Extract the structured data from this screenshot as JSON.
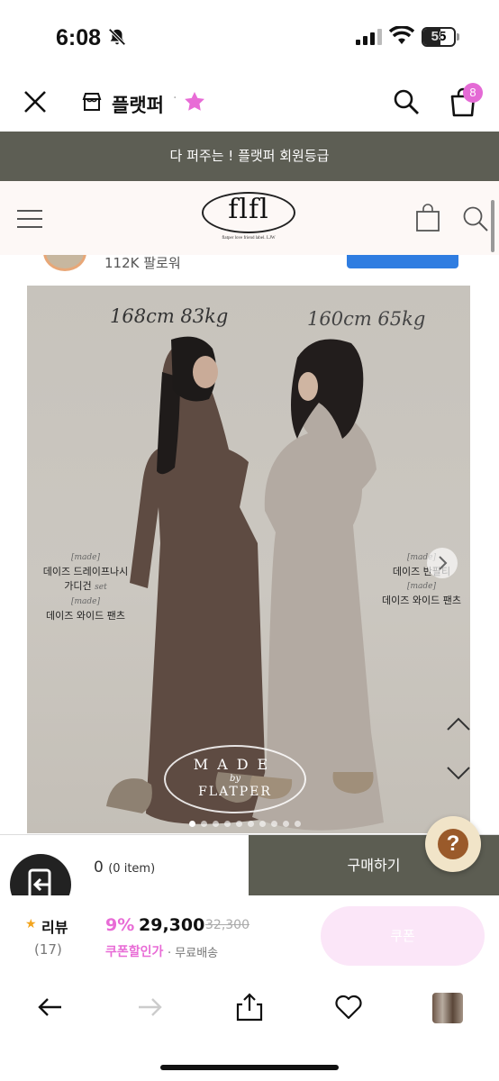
{
  "status_bar": {
    "time": "6:08",
    "battery": "55",
    "battery_level": 0.55
  },
  "app_header": {
    "store_name": "플랫퍼",
    "separator": "·",
    "cart_count": "8"
  },
  "banner": {
    "text": "다 퍼주는 ! 플랫퍼 회원등급"
  },
  "shop_header": {
    "logo_text": "flfl",
    "logo_tagline": "flatper love friend label. LJW"
  },
  "seller": {
    "followers": "112K 팔로워"
  },
  "product_image": {
    "left_model": "168cm 83kg",
    "right_model": "160cm 65kg",
    "left_caption": {
      "made1": "[made]",
      "line1": "데이즈 드레이프나시",
      "line2": "가디건",
      "set": "set",
      "made2": "[made]",
      "line3": "데이즈 와이드 팬츠"
    },
    "right_caption": {
      "made1": "[made]",
      "line1": "데이즈 반팔티",
      "made2": "[made]",
      "line2": "데이즈 와이드 팬츠"
    },
    "stamp": {
      "line1": "MADE",
      "line2": "by",
      "line3": "FLATPER"
    },
    "carousel": {
      "total": 10,
      "active": 0
    }
  },
  "buy_bar": {
    "count": "0",
    "count_suffix": "(0 item)",
    "buy_label": "구매하기"
  },
  "summary": {
    "review_label": "리뷰",
    "review_count": "(17)",
    "discount": "9%",
    "price": "29,300",
    "original_price": "32,300",
    "coupon_label": "쿠폰할인가",
    "shipping_sep": "·",
    "shipping": "무료배송",
    "cta_label": "쿠폰"
  },
  "help": {
    "symbol": "?"
  },
  "colors": {
    "accent_pink": "#e86cd6",
    "banner_bg": "#5d5e54",
    "follow_blue": "#2f7de1",
    "buy_bg": "#5c5d52"
  }
}
